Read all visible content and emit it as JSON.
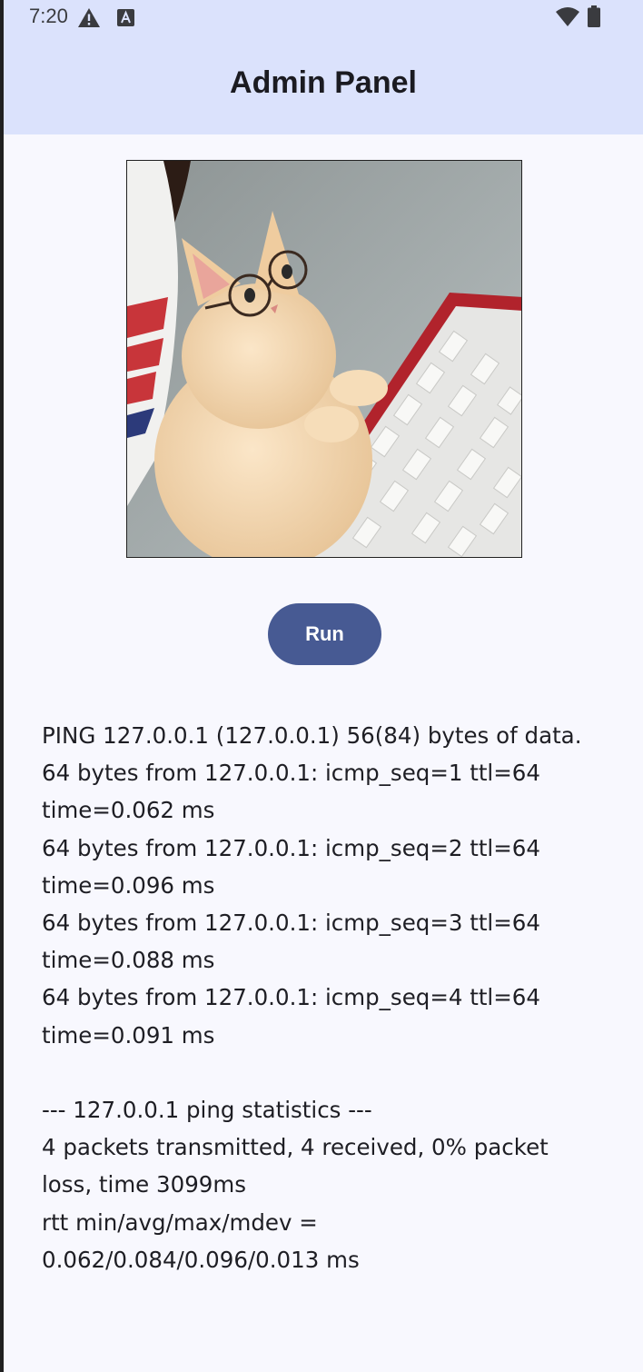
{
  "status_bar": {
    "time": "7:20",
    "left_icons": [
      "warning-icon",
      "keyboard-a-icon"
    ],
    "right_icons": [
      "wifi-icon",
      "battery-icon"
    ]
  },
  "app_bar": {
    "title": "Admin Panel"
  },
  "image": {
    "description_icon": "cat-at-keyboard-image"
  },
  "run_button": {
    "label": "Run"
  },
  "output": {
    "text": "PING 127.0.0.1 (127.0.0.1) 56(84) bytes of data.\n64 bytes from 127.0.0.1: icmp_seq=1 ttl=64 time=0.062 ms\n64 bytes from 127.0.0.1: icmp_seq=2 ttl=64 time=0.096 ms\n64 bytes from 127.0.0.1: icmp_seq=3 ttl=64 time=0.088 ms\n64 bytes from 127.0.0.1: icmp_seq=4 ttl=64 time=0.091 ms\n\n--- 127.0.0.1 ping statistics ---\n4 packets transmitted, 4 received, 0% packet loss, time 3099ms\nrtt min/avg/max/mdev = 0.062/0.084/0.096/0.013 ms"
  },
  "colors": {
    "app_bar_bg": "#dbe2fc",
    "page_bg": "#f8f8fe",
    "button_bg": "#475a93",
    "button_text": "#ffffff"
  }
}
